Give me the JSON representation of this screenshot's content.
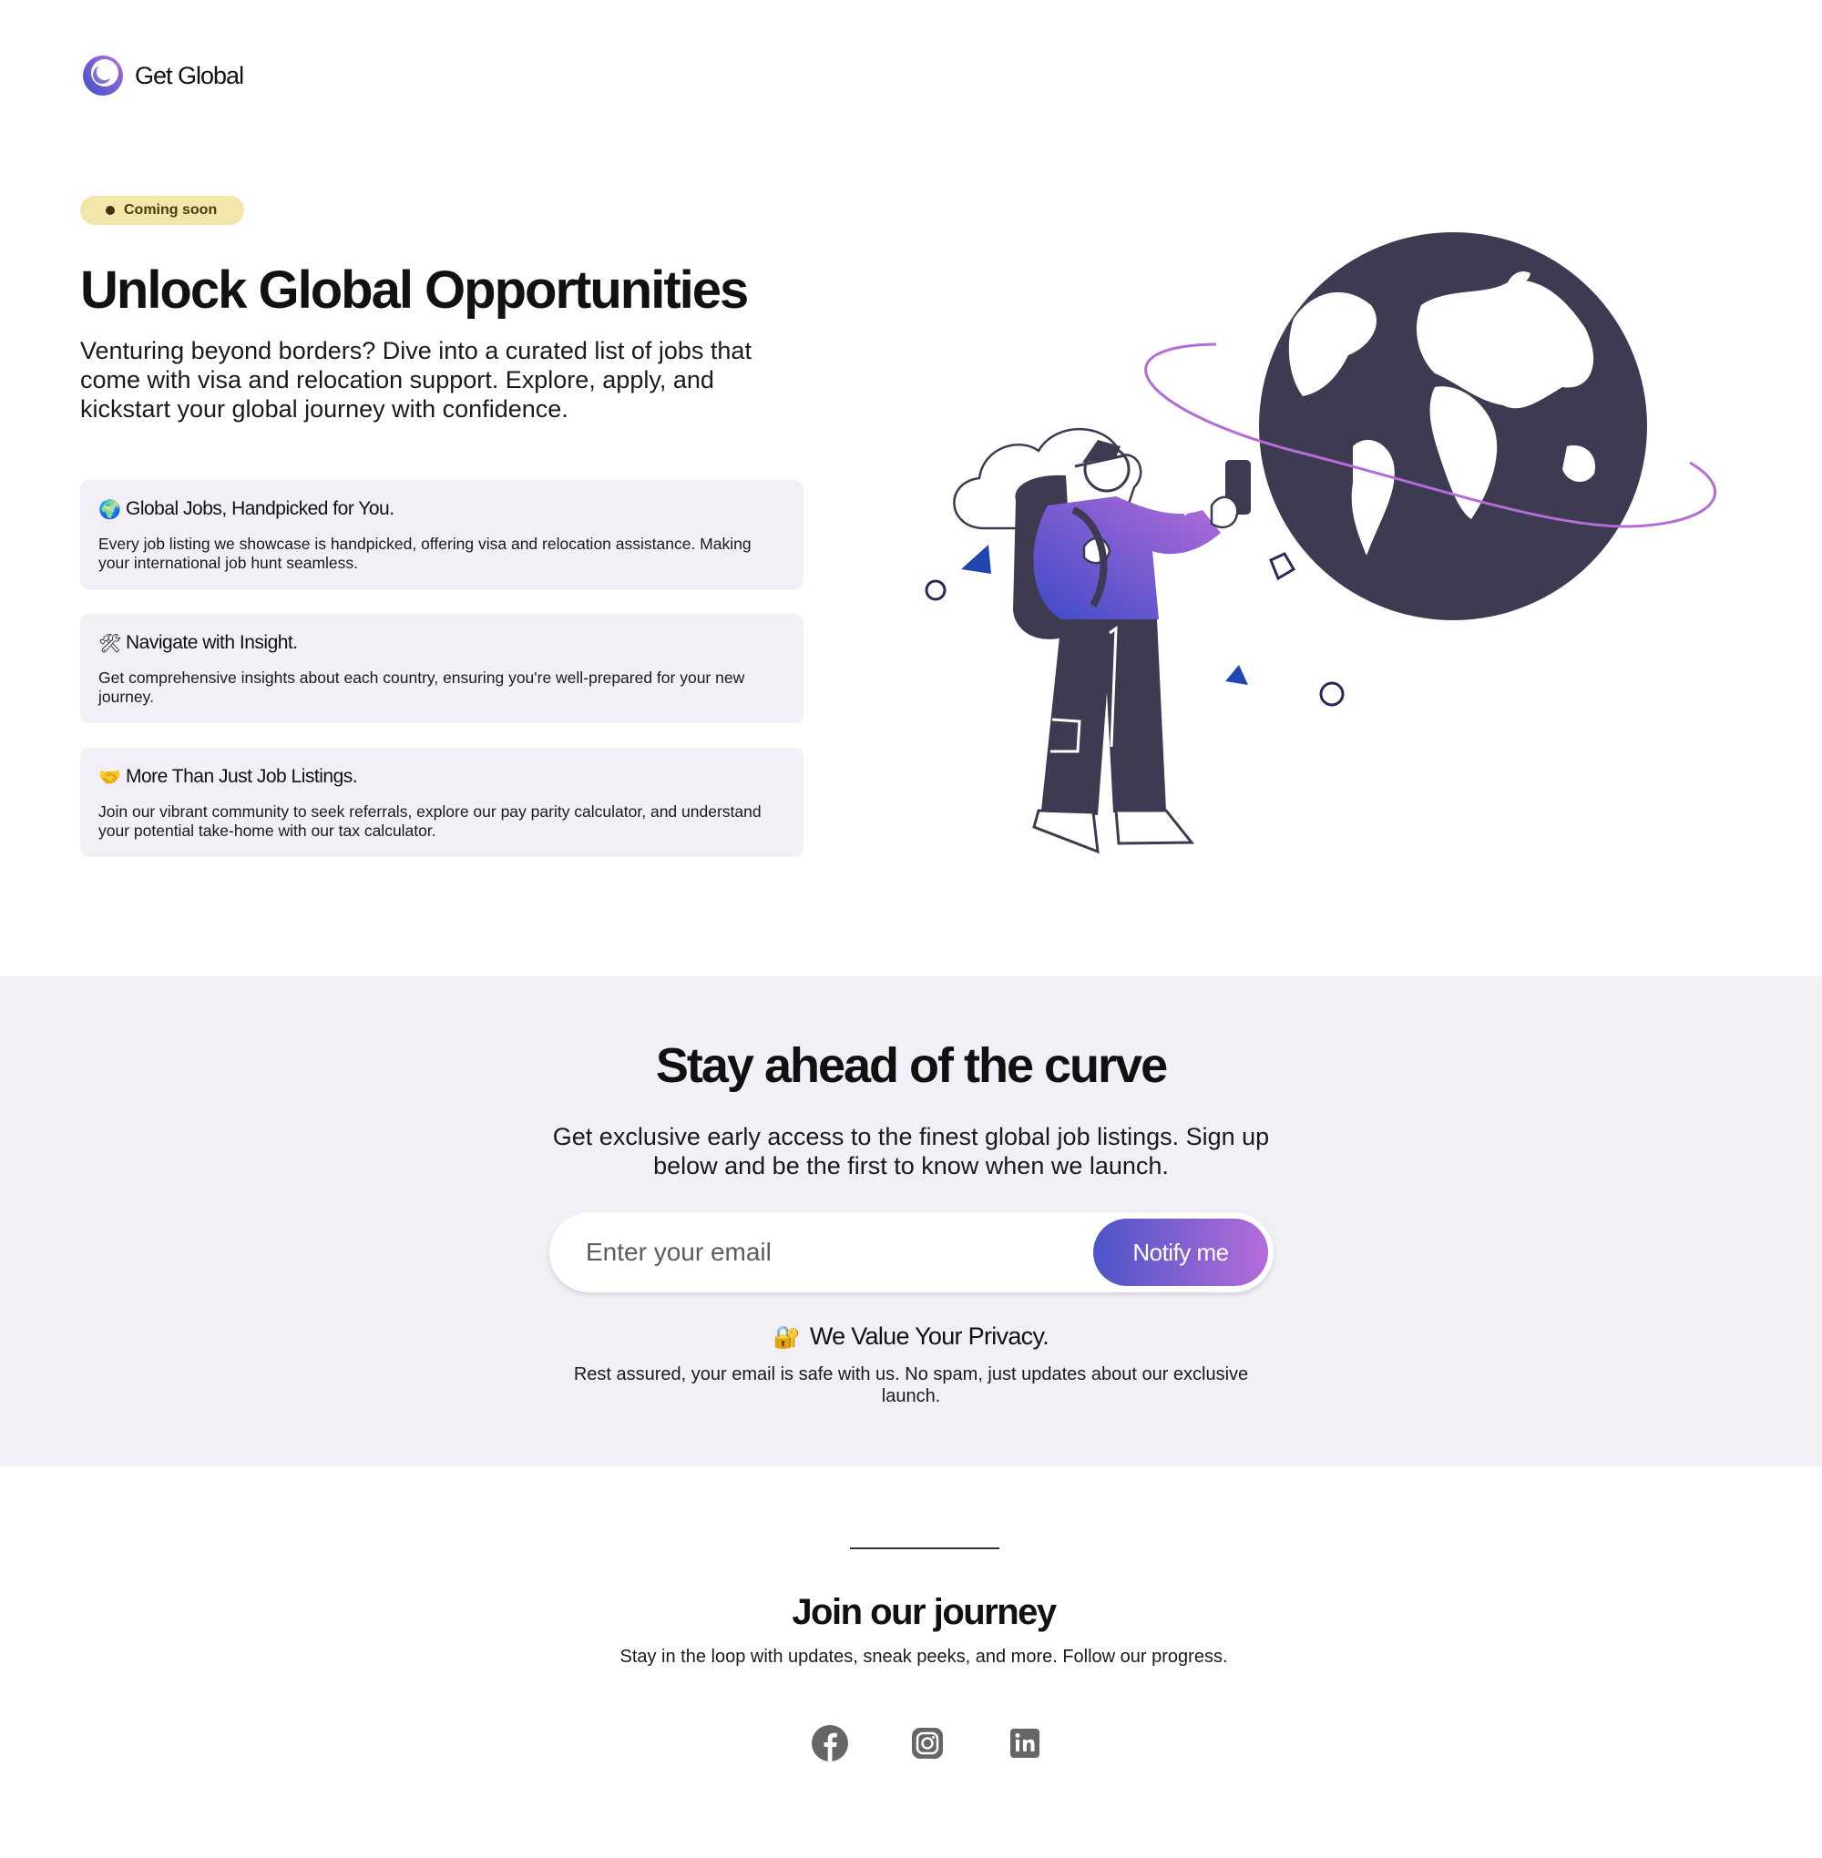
{
  "brand": {
    "name": "Get Global"
  },
  "hero": {
    "badge": "Coming soon",
    "title": "Unlock Global Opportunities",
    "subtitle": "Venturing beyond borders? Dive into a curated list of jobs that come with visa and relocation support. Explore, apply, and kickstart your global journey with confidence.",
    "features": [
      {
        "emoji": "🌍",
        "title": "Global Jobs, Handpicked for You.",
        "desc": "Every job listing we showcase is handpicked, offering visa and relocation assistance. Making your international job hunt seamless."
      },
      {
        "emoji": "🛠",
        "title": "Navigate with Insight.",
        "desc": "Get comprehensive insights about each country, ensuring you're well-prepared for your new journey."
      },
      {
        "emoji": "🤝",
        "title": "More Than Just Job Listings.",
        "desc": "Join our vibrant community to seek referrals, explore our pay parity calculator, and understand your potential take-home with our tax calculator."
      }
    ]
  },
  "signup": {
    "title": "Stay ahead of the curve",
    "subtitle": "Get exclusive early access to the finest global job listings. Sign up below and be the first to know when we launch.",
    "email_placeholder": "Enter your email",
    "button_label": "Notify me",
    "privacy_emoji": "🔐",
    "privacy_title": "We Value Your Privacy.",
    "privacy_desc": "Rest assured, your email is safe with us. No spam, just updates about our exclusive launch."
  },
  "footer": {
    "title": "Join our journey",
    "subtitle": "Stay in the loop with updates, sneak peeks, and more. Follow our progress.",
    "socials": [
      "facebook-icon",
      "instagram-icon",
      "linkedin-icon"
    ]
  },
  "colors": {
    "accent_start": "#4d55c9",
    "accent_end": "#b46cd9",
    "badge_bg": "#f3e6ab",
    "card_bg": "#f2eff6",
    "globe": "#3d3a52",
    "icon_gray": "#666666"
  }
}
